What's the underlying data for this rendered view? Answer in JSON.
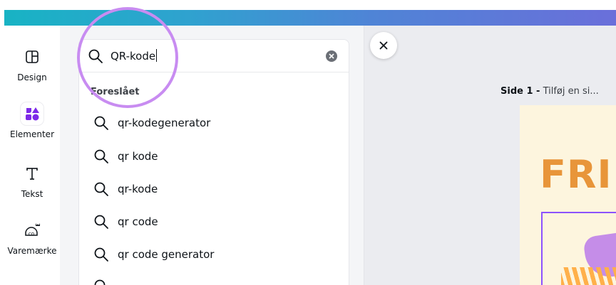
{
  "sidebar": {
    "items": [
      {
        "label": "Design",
        "icon": "layout-icon"
      },
      {
        "label": "Elementer",
        "icon": "shapes-icon",
        "active": true
      },
      {
        "label": "Tekst",
        "icon": "text-icon"
      },
      {
        "label": "Varemærke",
        "icon": "brand-kit-icon"
      }
    ]
  },
  "search": {
    "value": "QR-kode",
    "suggest_header": "Foreslået",
    "suggestions": [
      "qr-kodegenerator",
      "qr kode",
      "qr-kode",
      "qr code",
      "qr code generator"
    ]
  },
  "canvas": {
    "page_number_label": "Side 1 -",
    "page_title_placeholder": "Tilføj en si...",
    "design_text": "FRI"
  },
  "colors": {
    "accent_purple": "#8c52ff",
    "highlight_circle": "#c88cf1",
    "design_orange": "#e8953a",
    "gradient_start": "#18b3c4",
    "gradient_end": "#6a6fda"
  }
}
